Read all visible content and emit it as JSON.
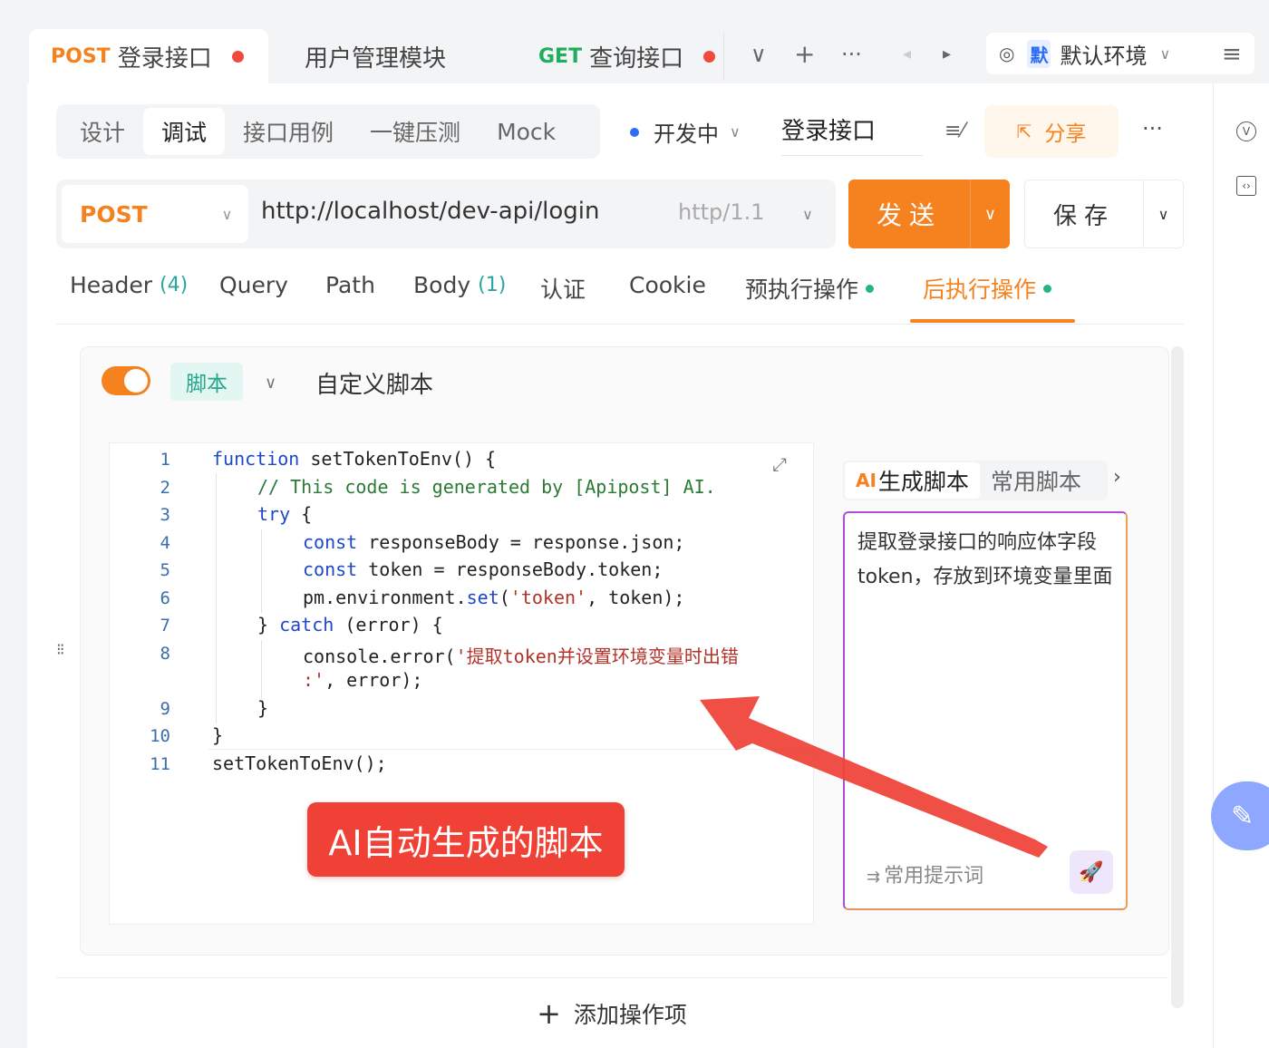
{
  "top_tabs": [
    {
      "method": "POST",
      "label": "登录接口",
      "active": true,
      "unsaved": true
    },
    {
      "method": "",
      "label": "用户管理模块",
      "active": false,
      "unsaved": false
    },
    {
      "method": "GET",
      "label": "查询接口",
      "active": false,
      "unsaved": true
    }
  ],
  "tabbar_icons": {
    "dropdown": "∨",
    "add": "+",
    "more": "···",
    "prev": "◂",
    "next": "▸",
    "menu": "≡"
  },
  "environment": {
    "badge": "默",
    "label": "默认环境"
  },
  "sub_tabs": [
    "设计",
    "调试",
    "接口用例",
    "一键压测",
    "Mock"
  ],
  "active_sub_tab": "调试",
  "status": "开发中",
  "api_name": "登录接口",
  "share_label": "分享",
  "header_more": "···",
  "request": {
    "method": "POST",
    "url": "http://localhost/dev-api/login",
    "http_version": "http/1.1",
    "send_label": "发送",
    "save_label": "保存"
  },
  "request_tabs": [
    {
      "label": "Header",
      "count": "(4)"
    },
    {
      "label": "Query",
      "count": ""
    },
    {
      "label": "Path",
      "count": ""
    },
    {
      "label": "Body",
      "count": "(1)"
    },
    {
      "label": "认证",
      "count": ""
    },
    {
      "label": "Cookie",
      "count": ""
    },
    {
      "label": "预执行操作",
      "count": ""
    },
    {
      "label": "后执行操作",
      "count": ""
    }
  ],
  "script_card": {
    "enabled": true,
    "type_label": "脚本",
    "title": "自定义脚本"
  },
  "code_line_numbers": [
    "1",
    "2",
    "3",
    "4",
    "5",
    "6",
    "7",
    "8",
    "",
    "9",
    "10",
    "11"
  ],
  "code_lines": [
    "function setTokenToEnv() {",
    "// This code is generated by [Apipost] AI.",
    "try {",
    "const responseBody = response.json;",
    "const token = responseBody.token;",
    "pm.environment.set('token', token);",
    "} catch (error) {",
    "console.error('提取token并设置环境变量时出错",
    ":', error);",
    "}",
    "}",
    "setTokenToEnv();"
  ],
  "annotation_label": "AI自动生成的脚本",
  "ai_panel": {
    "tab_ai_logo": "AI",
    "tab_ai": "生成脚本",
    "tab_common": "常用脚本",
    "more": "›",
    "prompt": "提取登录接口的响应体字段token，存放到环境变量里面",
    "hint": "常用提示词"
  },
  "add_operation": "添加操作项",
  "colors": {
    "accent_orange": "#f5821f",
    "annotation_red": "#ef4135",
    "keyword_blue": "#1f48c9",
    "comment_green": "#2c7a36",
    "string_red": "#b2332b"
  }
}
